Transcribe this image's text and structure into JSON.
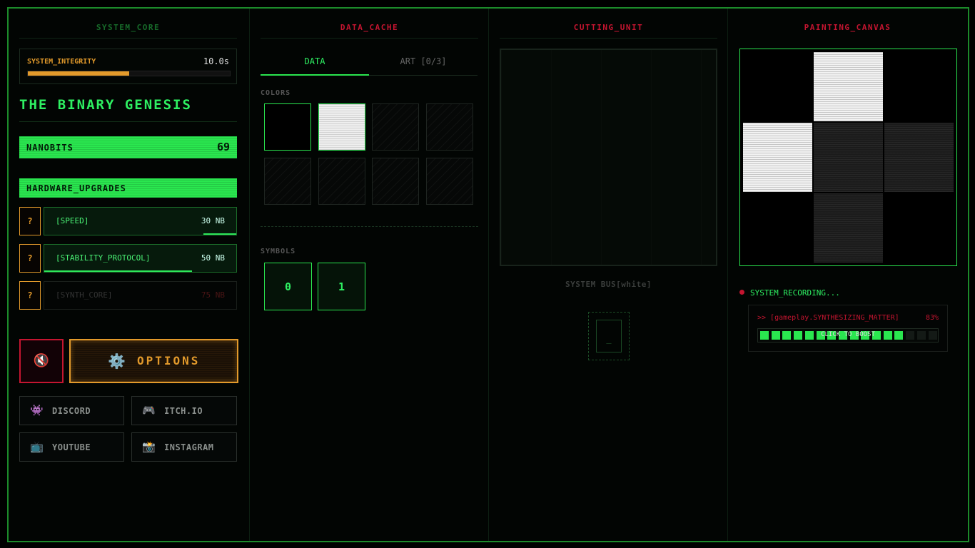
{
  "system_core": {
    "heading": "SYSTEM_CORE",
    "integrity_label": "SYSTEM_INTEGRITY",
    "integrity_time": "10.0s",
    "integrity_level": 0.5,
    "game_title": "THE BINARY GENESIS",
    "nanobits_label": "NANOBITS",
    "nanobits_value": "69",
    "upgrades_heading": "HARDWARE_UPGRADES",
    "upgrades": [
      {
        "lock": "?",
        "name": "[SPEED]",
        "cost": "30 NB",
        "progress": 0.17,
        "available": true
      },
      {
        "lock": "?",
        "name": "[STABILITY_PROTOCOL]",
        "cost": "50 NB",
        "progress": 0.77,
        "available": true
      },
      {
        "lock": "?",
        "name": "[SYNTH_CORE]",
        "cost": "75 NB",
        "progress": 0,
        "available": false
      }
    ],
    "mute_icon": "🔇",
    "options_icon": "⚙️",
    "options_label": "OPTIONS",
    "social": [
      {
        "icon": "👾",
        "icon_name": "alien-monster-icon",
        "label": "DISCORD"
      },
      {
        "icon": "🎮",
        "icon_name": "gamepad-icon",
        "label": "ITCH.IO"
      },
      {
        "icon": "📺",
        "icon_name": "television-icon",
        "label": "YOUTUBE"
      },
      {
        "icon": "📸",
        "icon_name": "camera-icon",
        "label": "INSTAGRAM"
      }
    ]
  },
  "data_cache": {
    "heading": "DATA_CACHE",
    "tabs": [
      "DATA",
      "ART [0/3]"
    ],
    "colors_label": "COLORS",
    "colors": [
      "black",
      "white",
      "empty",
      "empty",
      "empty",
      "empty",
      "empty",
      "empty"
    ],
    "symbols_label": "SYMBOLS",
    "symbols": [
      "0",
      "1"
    ]
  },
  "cutting_unit": {
    "heading": "CUTTING_UNIT",
    "status": "SYSTEM BUS[white]",
    "slot_symbol": "_"
  },
  "painting_canvas": {
    "heading": "PAINTING_CANVAS",
    "cells": [
      "black",
      "white",
      "black",
      "white",
      "dark",
      "dark",
      "black",
      "dark",
      "black"
    ],
    "recording_label": "SYSTEM_RECORDING...",
    "process_text": ">> [gameplay.SYNTHESIZING_MATTER]",
    "process_pct": "83%",
    "process_fraction": 0.83,
    "boost_label": "CLICK TO BOOST",
    "accent_green": "#2ae64f",
    "accent_red": "#c41530",
    "accent_orange": "#e39a2b"
  }
}
